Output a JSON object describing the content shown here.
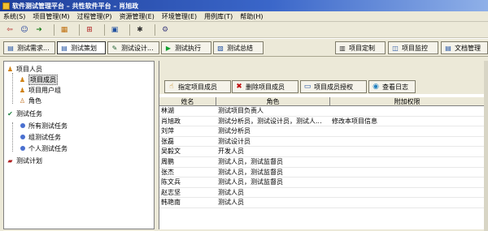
{
  "window": {
    "title": "软件测试管理平台 – 共性软件平台 – 肖旭政"
  },
  "menu": [
    "系统(S)",
    "项目管理(M)",
    "过程管理(P)",
    "资源管理(E)",
    "环境管理(E)",
    "用例库(T)",
    "帮助(H)"
  ],
  "toolbar_icons": [
    "exit-icon",
    "user-icon",
    "import-icon",
    "chart-icon",
    "tree-icon",
    "report-icon",
    "bug-icon",
    "settings-icon"
  ],
  "tabs": [
    {
      "label": "测试需求...",
      "icon": "doc-icon",
      "active": false
    },
    {
      "label": "测试策划",
      "icon": "plan-icon",
      "active": true
    },
    {
      "label": "测试设计...",
      "icon": "design-icon",
      "active": false
    },
    {
      "label": "测试执行",
      "icon": "run-icon",
      "active": false
    },
    {
      "label": "测试总结",
      "icon": "summary-icon",
      "active": false
    },
    {
      "label": "项目定制",
      "icon": "custom-icon",
      "active": false
    },
    {
      "label": "项目监控",
      "icon": "monitor-icon",
      "active": false
    },
    {
      "label": "文档管理",
      "icon": "docmgr-icon",
      "active": false
    }
  ],
  "tree": {
    "project_people": "项目人员",
    "project_members": "项目成员",
    "project_user_groups": "项目用户组",
    "roles": "角色",
    "test_tasks": "测试任务",
    "all_tasks": "所有测试任务",
    "group_tasks": "组测试任务",
    "personal_tasks": "个人测试任务",
    "test_plan": "测试计划"
  },
  "actions": {
    "assign": "指定项目成员",
    "delete": "删除项目成员",
    "authorize": "项目成员授权",
    "log": "查看日志"
  },
  "grid": {
    "headers": [
      "姓名",
      "角色",
      "附加权限"
    ],
    "rows": [
      {
        "name": "林湖",
        "role": "测试项目负责人",
        "extra": ""
      },
      {
        "name": "肖旭政",
        "role": "测试分析员，测试设计员，测试人...",
        "extra": "修改本项目信息"
      },
      {
        "name": "刘萍",
        "role": "测试分析员",
        "extra": ""
      },
      {
        "name": "张磊",
        "role": "测试设计员",
        "extra": ""
      },
      {
        "name": "吴毅文",
        "role": "开发人员",
        "extra": ""
      },
      {
        "name": "周鹏",
        "role": "测试人员，测试监督员",
        "extra": ""
      },
      {
        "name": "张杰",
        "role": "测试人员，测试监督员",
        "extra": ""
      },
      {
        "name": "陈文兵",
        "role": "测试人员，测试监督员",
        "extra": ""
      },
      {
        "name": "赵志坚",
        "role": "测试人员",
        "extra": ""
      },
      {
        "name": "韩艳南",
        "role": "测试人员",
        "extra": ""
      }
    ]
  }
}
